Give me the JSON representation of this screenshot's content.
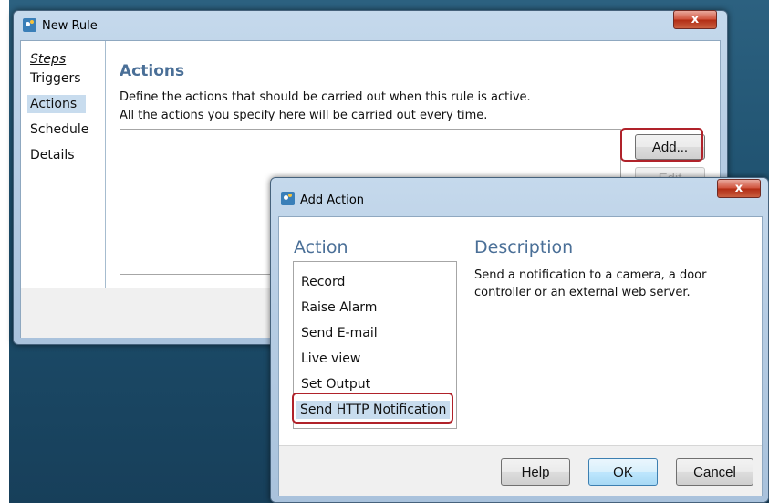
{
  "desktop": {
    "background": "#1d4f6d"
  },
  "new_rule": {
    "title": "New Rule",
    "close": "x",
    "steps_heading": "Steps",
    "steps": [
      "Triggers",
      "Actions",
      "Schedule",
      "Details"
    ],
    "selected_step": "Actions",
    "heading": "Actions",
    "description_line1": "Define the actions that should be carried out when this rule is active.",
    "description_line2": "All the actions you specify here will be carried out every time.",
    "add_label": "Add...",
    "edit_label": "Edit"
  },
  "add_action": {
    "title": "Add Action",
    "close": "x",
    "action_heading": "Action",
    "description_heading": "Description",
    "actions": [
      "Record",
      "Raise Alarm",
      "Send E-mail",
      "Live view",
      "Set Output",
      "Send HTTP Notification"
    ],
    "selected_action": "Send HTTP Notification",
    "description_text": "Send a notification to a camera, a door controller or an external web server.",
    "help_label": "Help",
    "ok_label": "OK",
    "cancel_label": "Cancel"
  },
  "colors": {
    "heading_blue": "#4a6f97",
    "highlight_red": "#b0222a",
    "selection": "#c8dcee"
  }
}
